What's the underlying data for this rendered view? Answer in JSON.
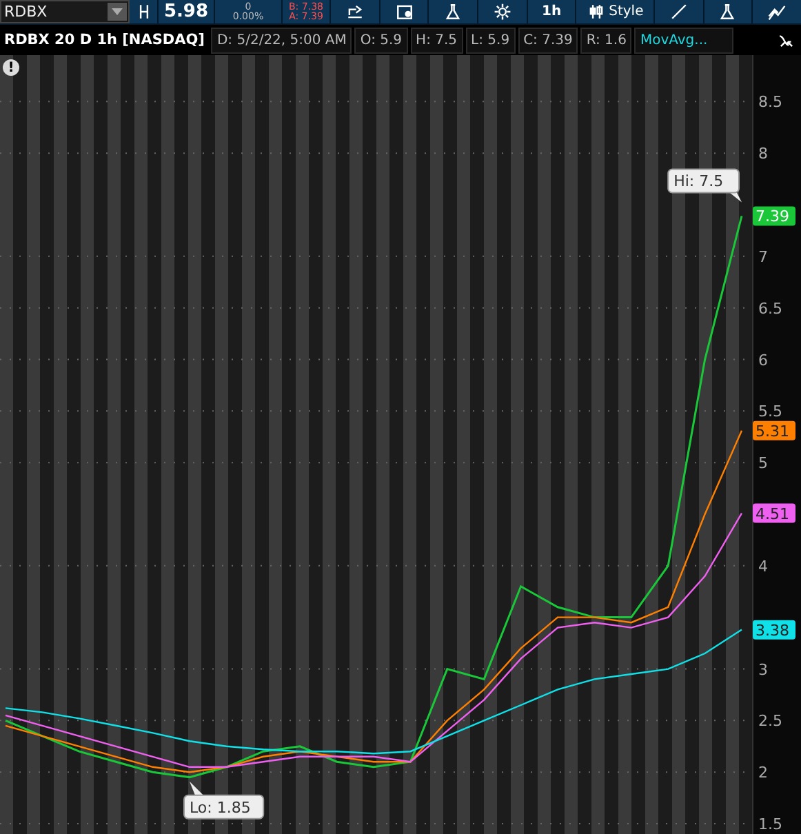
{
  "toolbar": {
    "symbol": "RDBX",
    "last_price": "5.98",
    "change": "0",
    "change_percent": "0.00%",
    "bid": "B: 7.38",
    "ask": "A: 7.39",
    "interval": "1h",
    "style_label": "Style"
  },
  "info_bar": {
    "title": "RDBX 20 D 1h [NASDAQ]",
    "fields": [
      "D: 5/2/22, 5:00 AM",
      "O: 5.9",
      "H: 7.5",
      "L: 5.9",
      "C: 7.39",
      "R: 1.6"
    ],
    "study": "MovAvg..."
  },
  "chart": {
    "alert_mark": "!",
    "chart_data": {
      "type": "line",
      "grid": true,
      "ylim": [
        1.4,
        8.95
      ],
      "yticks": [
        1.5,
        2,
        2.5,
        3,
        4,
        5,
        5.5,
        6,
        6.5,
        7,
        8,
        8.5
      ],
      "series": [
        {
          "color": "#19c739",
          "values": [
            2.5,
            2.35,
            2.2,
            2.1,
            2.0,
            1.95,
            2.05,
            2.2,
            2.25,
            2.1,
            2.05,
            2.1,
            3.0,
            2.9,
            3.8,
            3.6,
            3.5,
            3.5,
            4.0,
            6.0,
            7.39
          ]
        },
        {
          "color": "#ff8000",
          "values": [
            2.45,
            2.35,
            2.25,
            2.15,
            2.05,
            2.0,
            2.05,
            2.15,
            2.2,
            2.15,
            2.1,
            2.1,
            2.5,
            2.8,
            3.2,
            3.5,
            3.5,
            3.45,
            3.6,
            4.5,
            5.31
          ]
        },
        {
          "color": "#f060f0",
          "values": [
            2.55,
            2.45,
            2.35,
            2.25,
            2.15,
            2.05,
            2.05,
            2.1,
            2.15,
            2.15,
            2.15,
            2.1,
            2.4,
            2.7,
            3.1,
            3.4,
            3.45,
            3.4,
            3.5,
            3.9,
            4.51
          ]
        },
        {
          "color": "#10e0e8",
          "values": [
            2.62,
            2.58,
            2.52,
            2.45,
            2.38,
            2.3,
            2.25,
            2.22,
            2.2,
            2.2,
            2.18,
            2.2,
            2.35,
            2.5,
            2.65,
            2.8,
            2.9,
            2.95,
            3.0,
            3.15,
            3.38
          ]
        }
      ],
      "annotations": [
        "Hi: 7.5",
        "Lo: 1.85"
      ]
    },
    "last_value_labels": [
      {
        "text": "7.39",
        "color": "#19c739"
      },
      {
        "text": "5.31",
        "color": "#ff8000"
      },
      {
        "text": "4.51",
        "color": "#f060f0"
      },
      {
        "text": "3.38",
        "color": "#10e0e8"
      }
    ]
  }
}
